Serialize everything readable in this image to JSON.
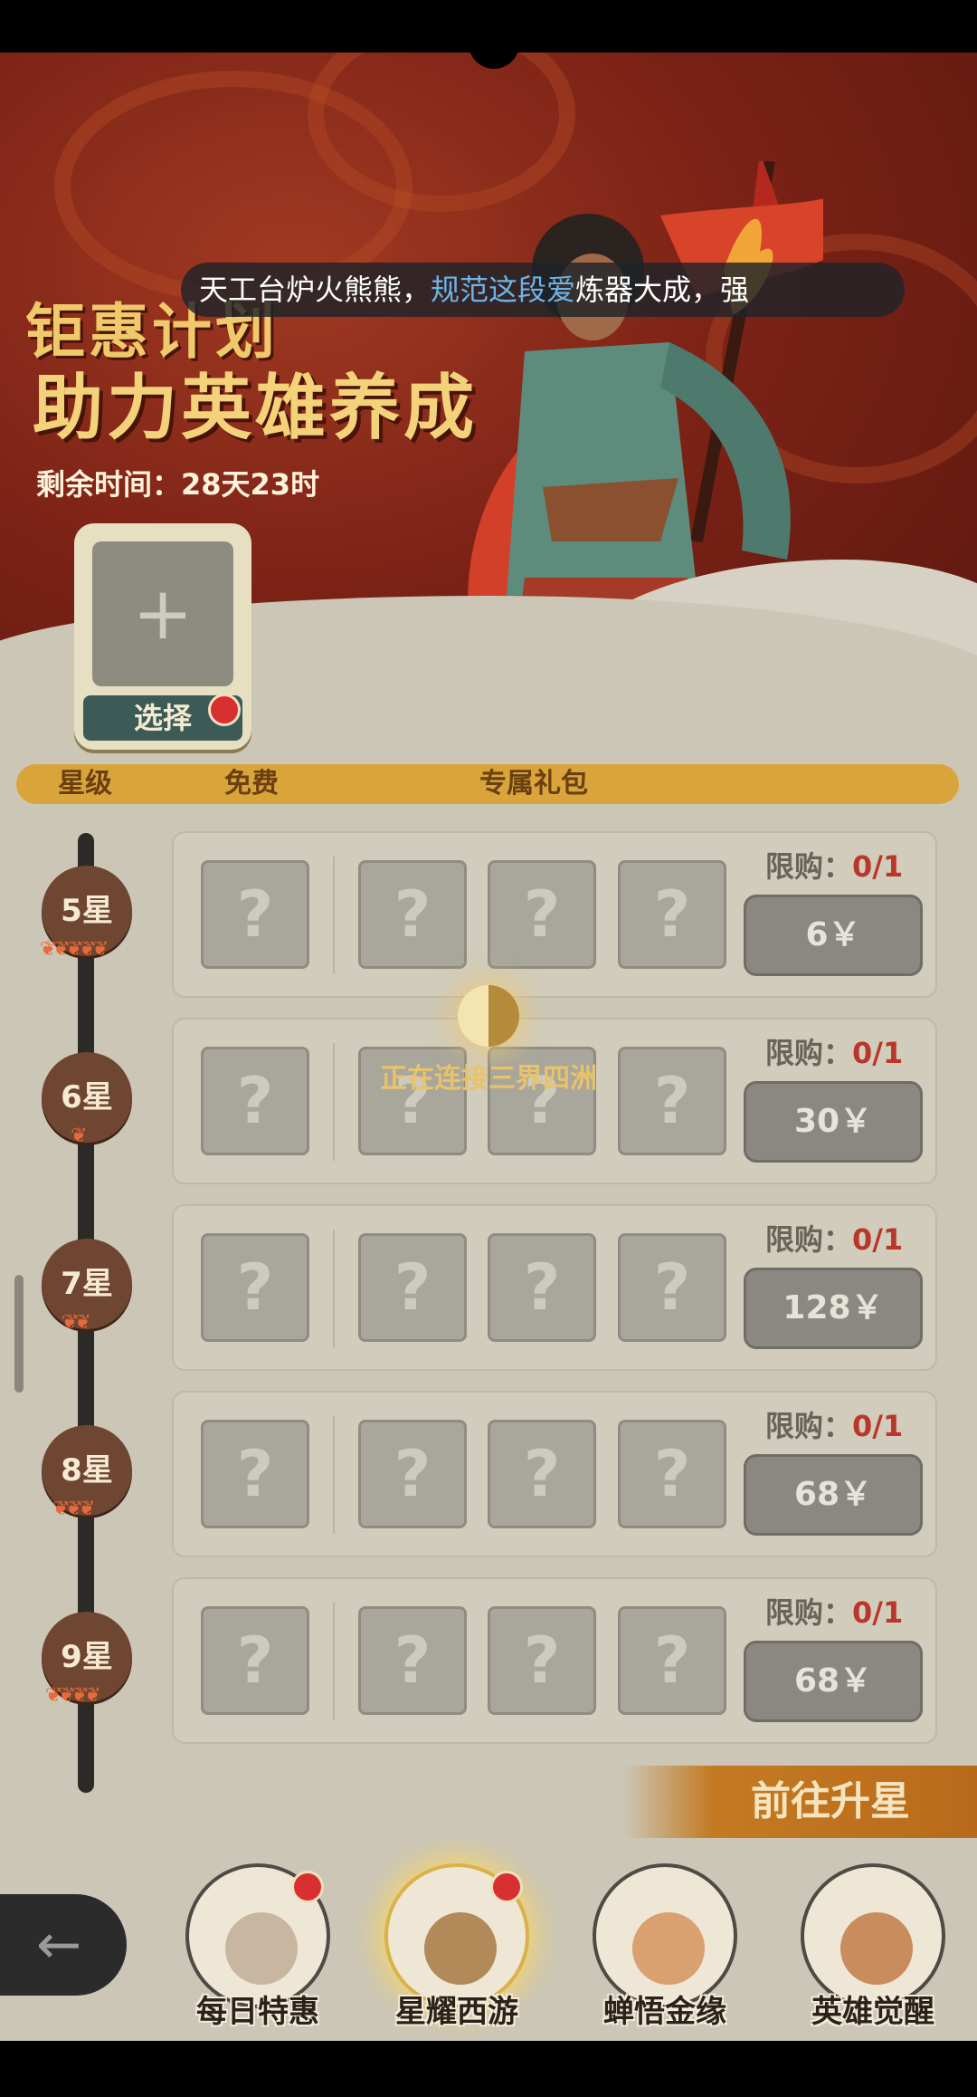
{
  "banner": {
    "ticker_plain1": "天工台炉火熊熊，",
    "ticker_highlight": "规范这段爱",
    "ticker_plain2": "炼器大成，强",
    "title_line1": "钜惠计划",
    "title_line2": "助力英雄养成",
    "timer": "剩余时间：28天23时",
    "select_plus": "+",
    "select_label": "选择"
  },
  "columns": {
    "star": "星级",
    "free": "免费",
    "pack": "专属礼包"
  },
  "rows": [
    {
      "star": "5星",
      "flames": "❦❦❦❦❦",
      "limit_label": "限购：",
      "limit_count": "0/1",
      "price": "6￥"
    },
    {
      "star": "6星",
      "flames": "❦",
      "limit_label": "限购：",
      "limit_count": "0/1",
      "price": "30￥"
    },
    {
      "star": "7星",
      "flames": "❦❦",
      "limit_label": "限购：",
      "limit_count": "0/1",
      "price": "128￥"
    },
    {
      "star": "8星",
      "flames": "❦❦❦",
      "limit_label": "限购：",
      "limit_count": "0/1",
      "price": "68￥"
    },
    {
      "star": "9星",
      "flames": "❦❦❦❦",
      "limit_label": "限购：",
      "limit_count": "0/1",
      "price": "68￥"
    }
  ],
  "unknown_mark": "?",
  "loading": "正在连接三界四洲",
  "goto_label": "前往升星",
  "back_icon": "←",
  "nav": [
    {
      "label": "每日特惠",
      "badge": true,
      "color": "#c9b6a0"
    },
    {
      "label": "星耀西游",
      "badge": true,
      "color": "#b28a5a"
    },
    {
      "label": "蝉悟金缘",
      "badge": false,
      "color": "#d9a070"
    },
    {
      "label": "英雄觉醒",
      "badge": false,
      "color": "#c98d5d"
    }
  ]
}
